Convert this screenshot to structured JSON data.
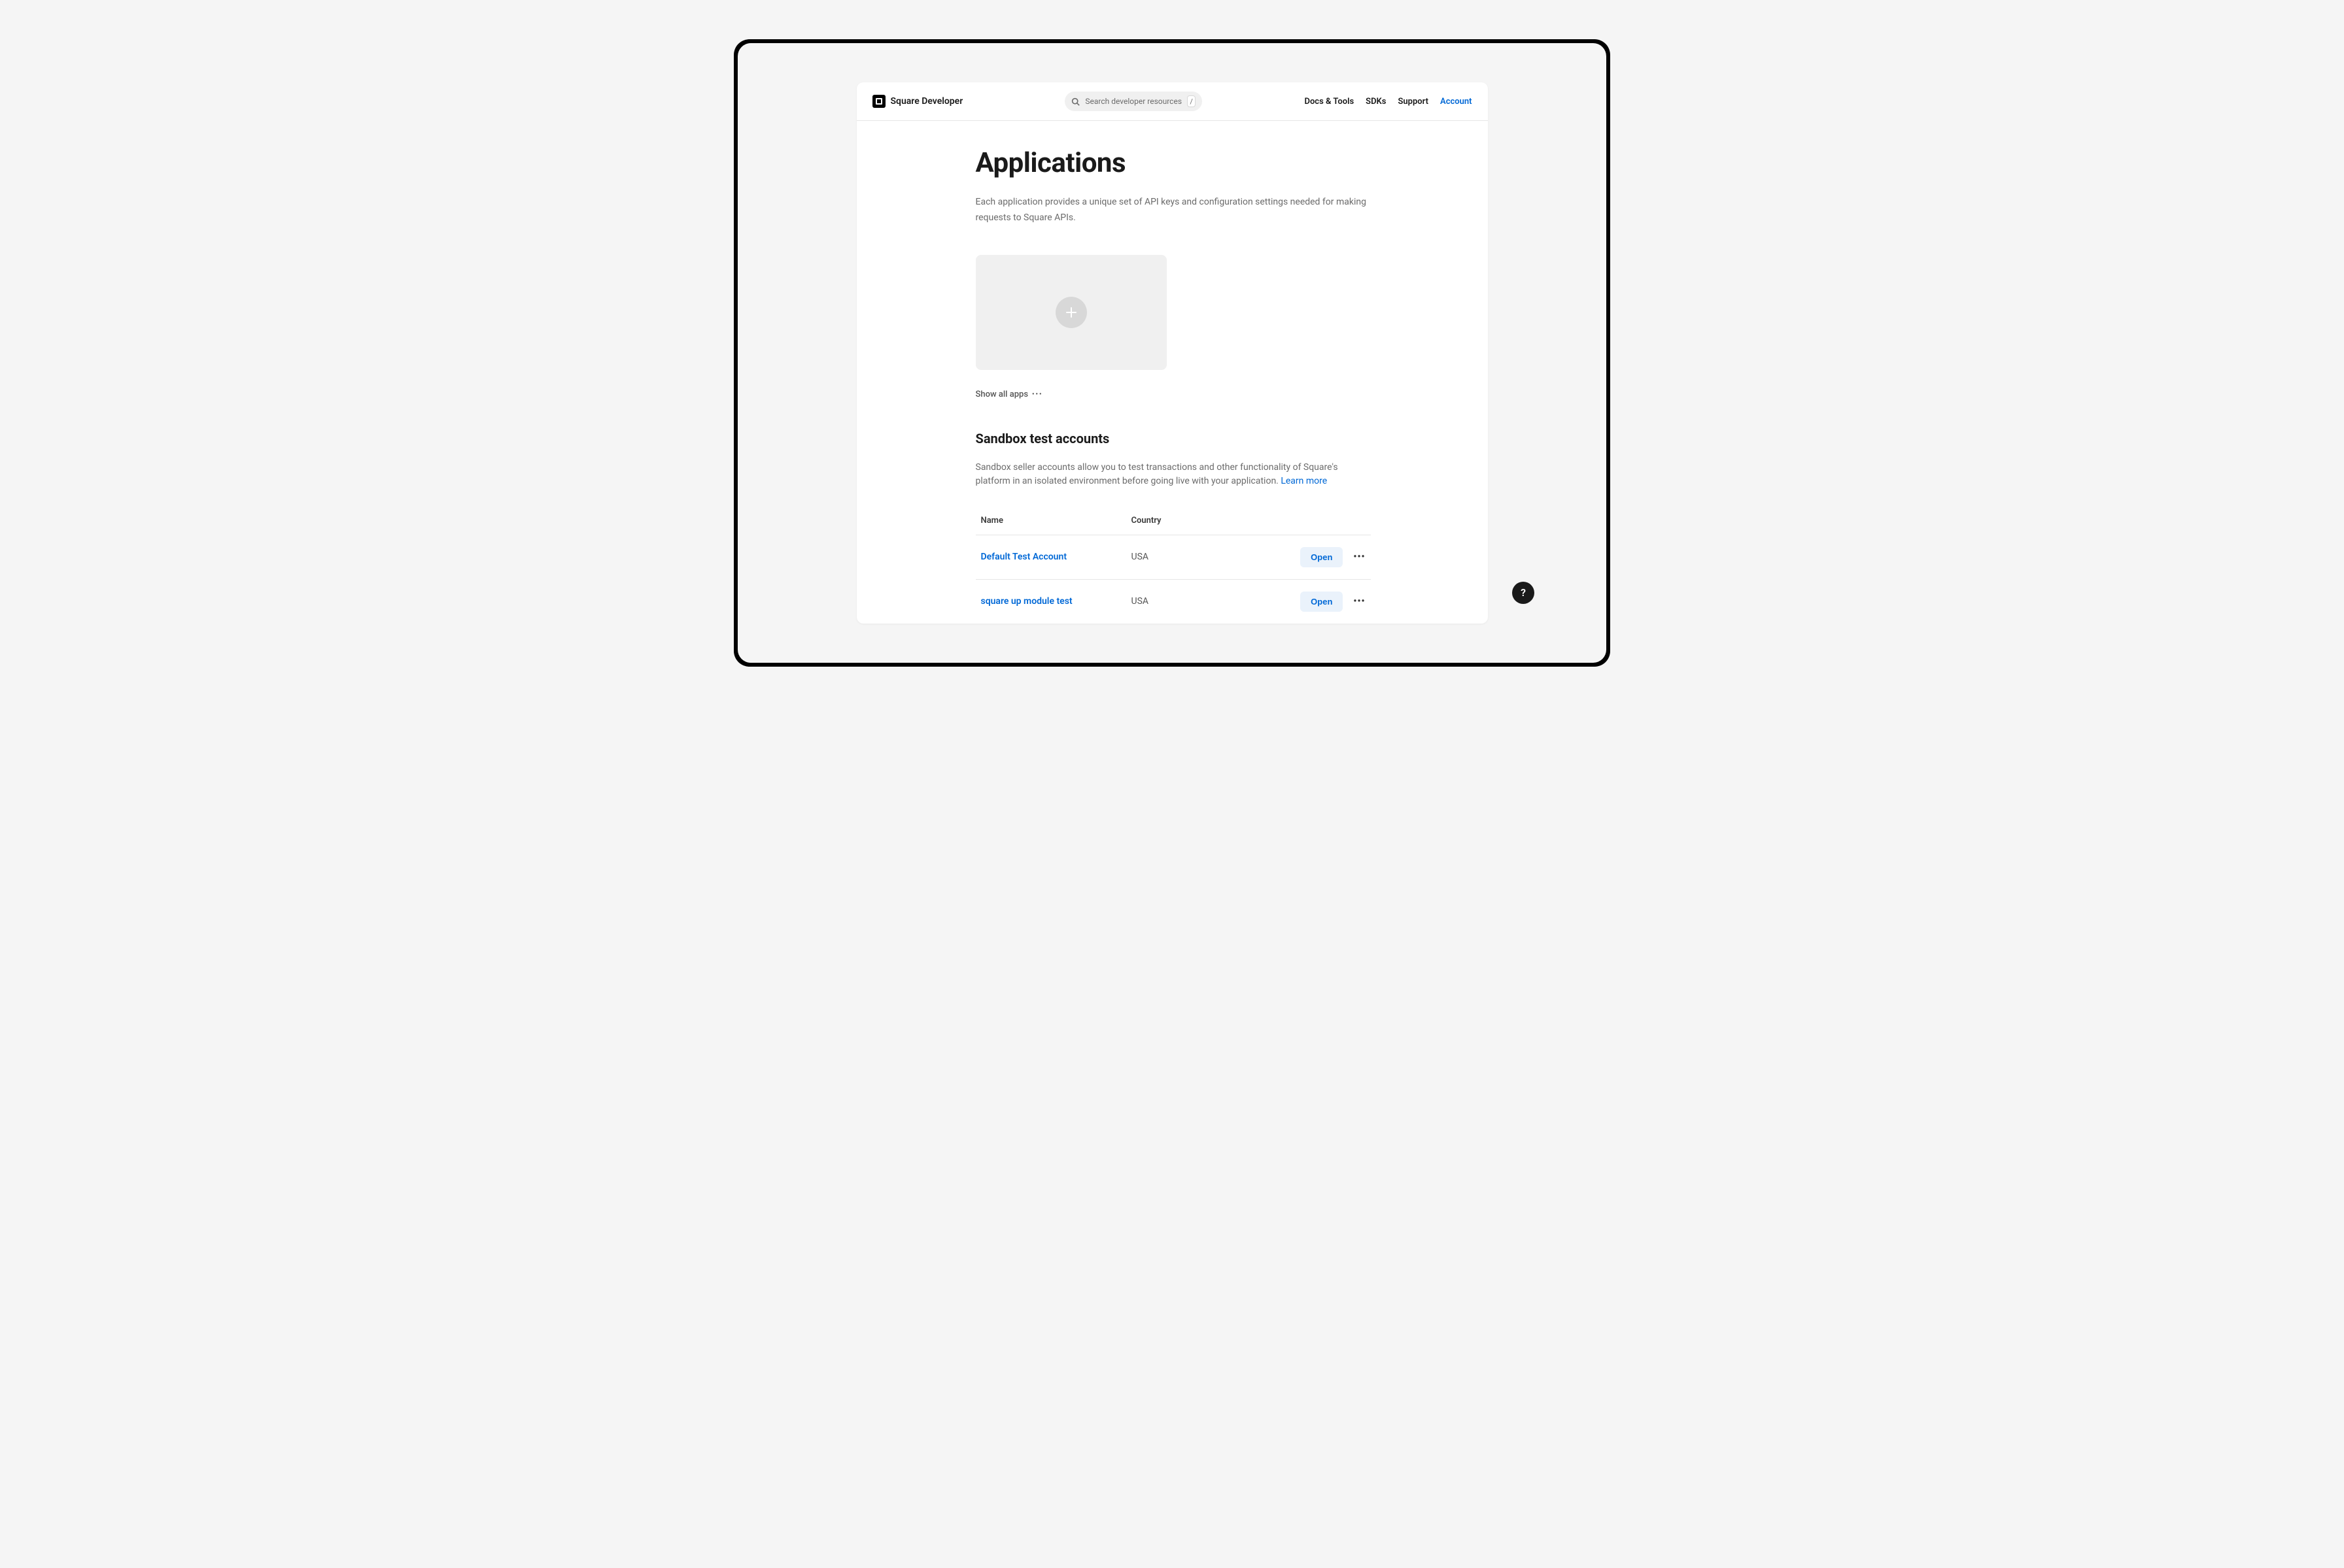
{
  "header": {
    "logo_text": "Square Developer",
    "search_placeholder": "Search developer resources",
    "search_shortcut": "/",
    "nav": [
      {
        "label": "Docs & Tools",
        "active": false
      },
      {
        "label": "SDKs",
        "active": false
      },
      {
        "label": "Support",
        "active": false
      },
      {
        "label": "Account",
        "active": true
      }
    ]
  },
  "page": {
    "title": "Applications",
    "description": "Each application provides a unique set of API keys and configuration settings needed for making requests to Square APIs.",
    "show_all_label": "Show all apps"
  },
  "sandbox": {
    "title": "Sandbox test accounts",
    "description": "Sandbox seller accounts allow you to test transactions and other functionality of Square's platform in an isolated environment before going live with your application. ",
    "learn_more": "Learn more",
    "columns": {
      "name": "Name",
      "country": "Country"
    },
    "open_label": "Open",
    "rows": [
      {
        "name": "Default Test Account",
        "country": "USA"
      },
      {
        "name": "square up module test",
        "country": "USA"
      }
    ]
  },
  "help_label": "?"
}
